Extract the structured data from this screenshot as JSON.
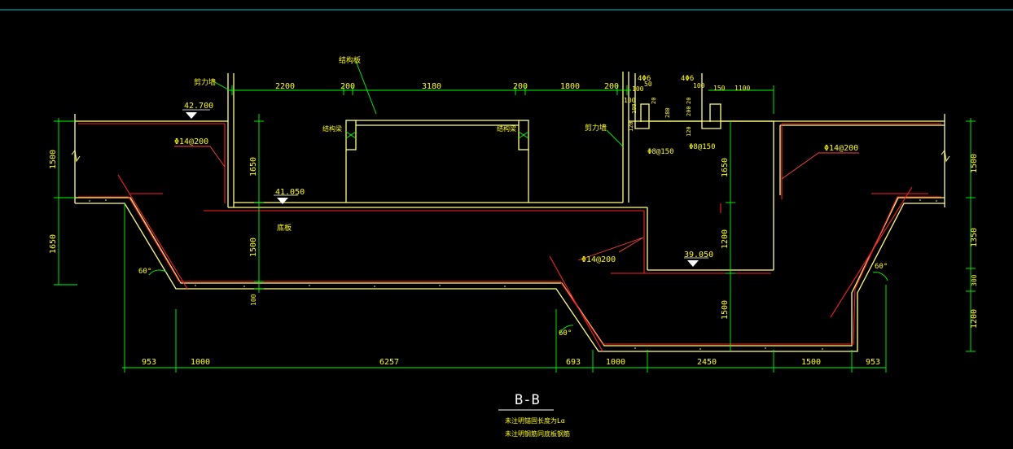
{
  "colors": {
    "background": "#000000",
    "structure": "#ffff80",
    "rebar": "#ff2020",
    "dimension": "#00ff00",
    "text": "#ffff00",
    "leader": "#ff4040",
    "top_border": "#00c8c8",
    "title": "#ffffff"
  },
  "title": {
    "section": "B-B",
    "note1": "未注明锚固长度为Lα",
    "note2": "未注明钢筋同底板钢筋"
  },
  "elevations": {
    "e1": "42.700",
    "e2": "41.050",
    "e3": "39.050"
  },
  "labels": {
    "shear_wall_left": "剪力墙",
    "shear_wall_right": "剪力墙",
    "structural_slab": "结构板",
    "beam_left": "结构梁",
    "beam_right": "结构梁",
    "bottom_slab": "底板",
    "rebar_1": "Φ14@200",
    "rebar_2": "Φ14@200",
    "rebar_3": "Φ14@200",
    "stirrup_1": "Φ8@150",
    "stirrup_2": "Φ8@150",
    "bar_1": "4Φ6",
    "bar_2": "4Φ6",
    "angle_1": "60°",
    "angle_2": "60°",
    "angle_3": "60°"
  },
  "top_dims": [
    "2200",
    "200",
    "3180",
    "200",
    "1800",
    "200",
    "100",
    "50",
    "150",
    "1100",
    "100",
    "100"
  ],
  "detail_dims": [
    "20",
    "280",
    "120",
    "20",
    "200",
    "120",
    "100"
  ],
  "left_dims": [
    "1500",
    "1650"
  ],
  "inner_dims": [
    "1650",
    "1500",
    "100",
    "1650",
    "1200",
    "1500"
  ],
  "right_dims": [
    "1500",
    "1350",
    "300",
    "1200"
  ],
  "bottom_dims": [
    "953",
    "1000",
    "6257",
    "693",
    "1000",
    "2450",
    "1500",
    "953"
  ]
}
